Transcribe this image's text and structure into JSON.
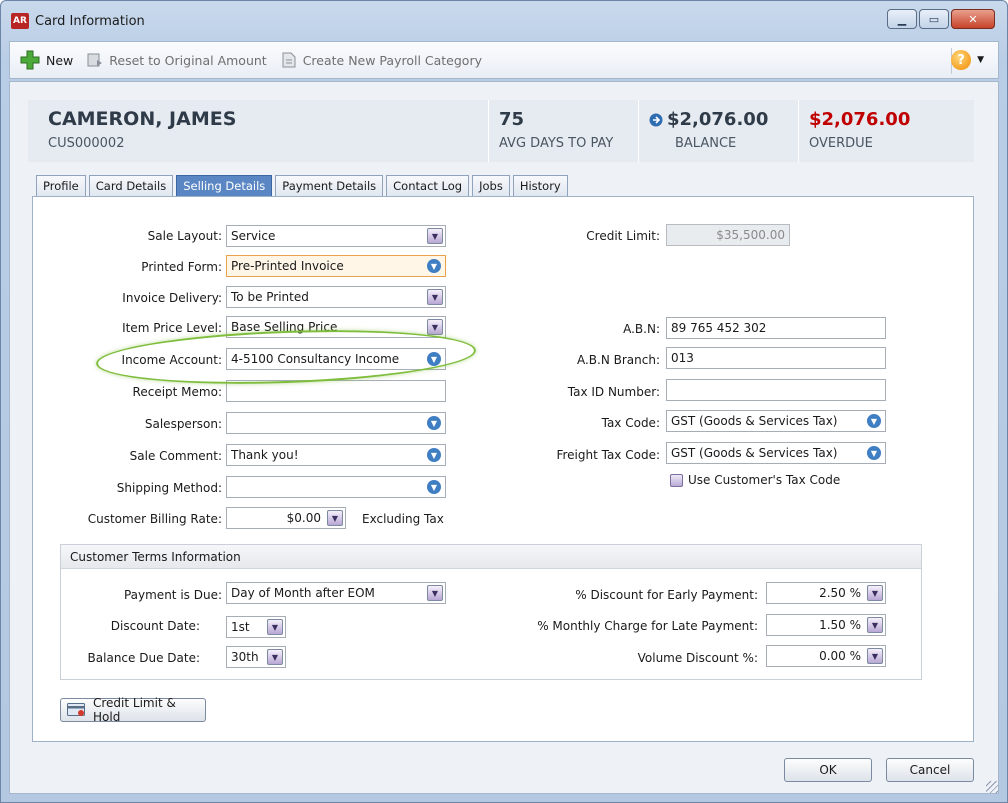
{
  "window": {
    "title": "Card Information",
    "app_badge": "AR"
  },
  "toolbar": {
    "new_label": "New",
    "reset_label": "Reset to Original Amount",
    "create_label": "Create New Payroll Category",
    "help_label": "?"
  },
  "header": {
    "name": "CAMERON, JAMES",
    "id": "CUS000002",
    "avg_days_value": "75",
    "avg_days_label": "AVG DAYS TO PAY",
    "balance_value": "$2,076.00",
    "balance_label": "BALANCE",
    "overdue_value": "$2,076.00",
    "overdue_label": "OVERDUE"
  },
  "tabs": [
    "Profile",
    "Card Details",
    "Selling Details",
    "Payment Details",
    "Contact Log",
    "Jobs",
    "History"
  ],
  "active_tab": "Selling Details",
  "left_form": {
    "sale_layout": {
      "label": "Sale Layout:",
      "value": "Service"
    },
    "printed_form": {
      "label": "Printed Form:",
      "value": "Pre-Printed Invoice"
    },
    "invoice_delivery": {
      "label": "Invoice Delivery:",
      "value": "To be Printed"
    },
    "item_price_level": {
      "label": "Item Price Level:",
      "value": "Base Selling Price"
    },
    "income_account": {
      "label": "Income Account:",
      "value": "4-5100 Consultancy Income"
    },
    "receipt_memo": {
      "label": "Receipt Memo:",
      "value": ""
    },
    "salesperson": {
      "label": "Salesperson:",
      "value": ""
    },
    "sale_comment": {
      "label": "Sale Comment:",
      "value": "Thank you!"
    },
    "shipping_method": {
      "label": "Shipping Method:",
      "value": ""
    },
    "billing_rate": {
      "label": "Customer Billing Rate:",
      "value": "$0.00",
      "suffix": "Excluding Tax"
    }
  },
  "right_form": {
    "credit_limit": {
      "label": "Credit Limit:",
      "value": "$35,500.00"
    },
    "abn": {
      "label": "A.B.N:",
      "value": "89 765 452 302"
    },
    "abn_branch": {
      "label": "A.B.N Branch:",
      "value": "013"
    },
    "tax_id": {
      "label": "Tax ID Number:",
      "value": ""
    },
    "tax_code": {
      "label": "Tax Code:",
      "value": "GST (Goods & Services Tax)"
    },
    "freight_tax_code": {
      "label": "Freight Tax Code:",
      "value": "GST (Goods & Services Tax)"
    },
    "use_customer_tax": {
      "label": "Use Customer's Tax Code"
    }
  },
  "terms": {
    "title": "Customer Terms Information",
    "payment_due": {
      "label": "Payment is Due:",
      "value": "Day of Month after EOM"
    },
    "discount_date": {
      "label": "Discount Date:",
      "value": "1st"
    },
    "balance_due_date": {
      "label": "Balance Due Date:",
      "value": "30th"
    },
    "early_discount": {
      "label": "% Discount for Early Payment:",
      "value": "2.50 %"
    },
    "late_charge": {
      "label": "% Monthly Charge for Late Payment:",
      "value": "1.50 %"
    },
    "volume_discount": {
      "label": "Volume Discount %:",
      "value": "0.00 %"
    }
  },
  "buttons": {
    "credit_hold": "Credit Limit & Hold",
    "ok": "OK",
    "cancel": "Cancel"
  },
  "colors": {
    "accent": "#5b86c4",
    "overdue": "#c00000",
    "highlight_oval": "#7fbd3d"
  }
}
